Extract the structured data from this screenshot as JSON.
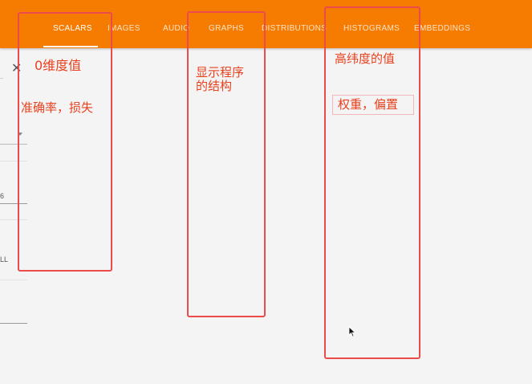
{
  "tabs": [
    {
      "label": "SCALARS",
      "active": true
    },
    {
      "label": "IMAGES",
      "active": false
    },
    {
      "label": "AUDIO",
      "active": false
    },
    {
      "label": "GRAPHS",
      "active": false
    },
    {
      "label": "DISTRIBUTIONS",
      "active": false
    },
    {
      "label": "HISTOGRAMS",
      "active": false
    },
    {
      "label": "EMBEDDINGS",
      "active": false
    }
  ],
  "sidebar": {
    "number_value": "6",
    "toggle_text": "LL"
  },
  "annotations": {
    "scalars_title": "0维度值",
    "scalars_desc": "准确率，损失",
    "graphs_line1": "显示程序",
    "graphs_line2": "的结构",
    "histograms_title": "高纬度的值",
    "histograms_desc": "权重，偏置"
  },
  "colors": {
    "topbar": "#f57c00",
    "annotation_red": "#e8411e"
  }
}
